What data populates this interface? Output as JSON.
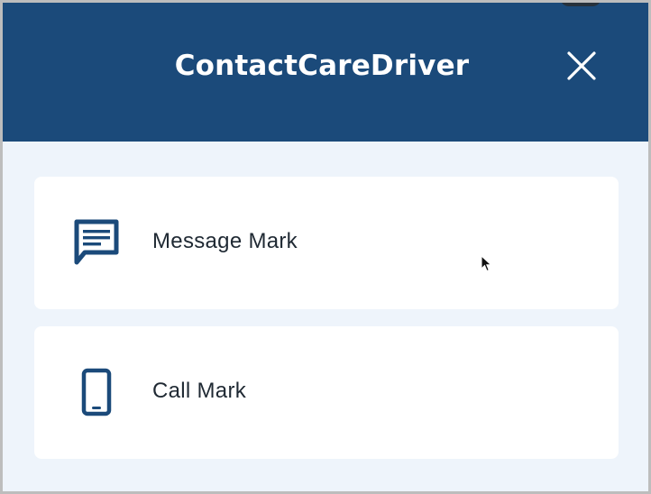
{
  "header": {
    "title": "ContactCareDriver",
    "close_icon": "close-icon"
  },
  "options": [
    {
      "label": "Message Mark",
      "icon": "message-icon"
    },
    {
      "label": "Call Mark",
      "icon": "phone-icon"
    }
  ],
  "colors": {
    "header_bg": "#1b4a7a",
    "page_bg": "#eef4fb",
    "card_bg": "#ffffff",
    "icon": "#1b4a7a",
    "text": "#1f2933"
  }
}
